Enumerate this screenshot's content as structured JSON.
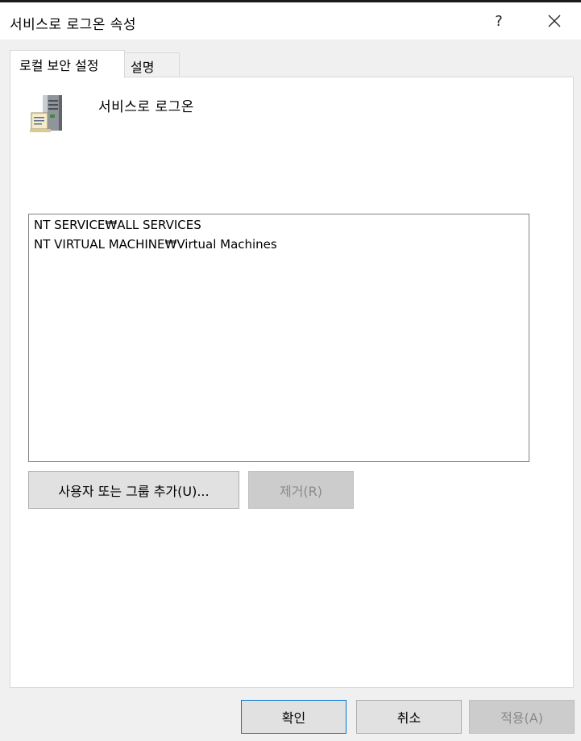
{
  "window": {
    "title": "서비스로 로그온 속성",
    "help_label": "?"
  },
  "tabs": [
    {
      "label": "로컬 보안 설정"
    },
    {
      "label": "설명"
    }
  ],
  "policy": {
    "name": "서비스로 로그온",
    "icon": "server-icon"
  },
  "members": [
    "NT SERVICE₩ALL SERVICES",
    "NT VIRTUAL MACHINE₩Virtual Machines"
  ],
  "buttons": {
    "add_label": "사용자 또는 그룹 추가(U)...",
    "remove_label": "제거(R)",
    "ok_label": "확인",
    "cancel_label": "취소",
    "apply_label": "적용(A)"
  },
  "colors": {
    "focus_border": "#0078d7",
    "disabled_text": "#8a8a8a"
  }
}
